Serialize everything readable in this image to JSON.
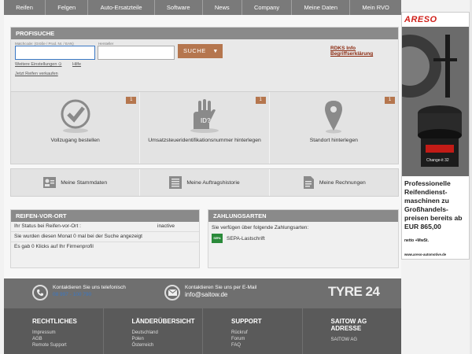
{
  "nav": {
    "items": [
      {
        "label": "Reifen"
      },
      {
        "label": "Felgen"
      },
      {
        "label": "Auto-Ersatzteile"
      },
      {
        "label": "Software"
      },
      {
        "label": "News"
      },
      {
        "label": "Company"
      },
      {
        "label": "Meine Daten"
      },
      {
        "label": "Mein RVO"
      }
    ]
  },
  "search": {
    "title": "PROFISUCHE",
    "field1_label": "Matchcode: (Größe / Prod. Nr. / EAN)",
    "field2_label": "Hersteller",
    "field1_value": "",
    "field2_value": "",
    "button_label": "SUCHE",
    "rdks_label": "RDKS Info",
    "legend_label": "Begriffserklärung",
    "more_settings": "Weitere Einstellungen",
    "help": "Hilfe",
    "sell_tires": "Jetzt Reifen verkaufen"
  },
  "tiles": [
    {
      "label": "Vollzugang bestellen",
      "badge": "1",
      "icon": "checkmark-circle-icon"
    },
    {
      "label": "Umsatzsteueridentifikationsnummer hinterlegen",
      "badge": "1",
      "icon": "id-hand-icon"
    },
    {
      "label": "Standort hinterlegen",
      "badge": "1",
      "icon": "location-pin-icon"
    }
  ],
  "tiles2": [
    {
      "label": "Meine Stammdaten",
      "icon": "profile-card-icon"
    },
    {
      "label": "Meine Auftragshistorie",
      "icon": "history-list-icon"
    },
    {
      "label": "Meine Rechnungen",
      "icon": "invoice-icon"
    }
  ],
  "reifen_vor_ort": {
    "title": "REIFEN-VOR-ORT",
    "status_label": "Ihr Status bei Reifen-vor-Ort :",
    "status_value": "inactive",
    "found_text": "Sie wurden diesen Monat 0 mal bei der Suche angezeigt",
    "clicks_text": "Es gab 0 Klicks auf Ihr Firmenprofil"
  },
  "zahlungsarten": {
    "title": "ZAHLUNGSARTEN",
    "intro": "Sie verfügen über folgende Zahlungsarten:",
    "method": "SEPA-Lastschrift",
    "method_icon_text": "SEPA"
  },
  "footer": {
    "phone_label": "Kontaktieren Sie uns telefonisch",
    "phone_number": "08 997 - 100 790",
    "email_label": "Kontaktieren Sie uns per E-Mail",
    "email": "info@saitow.de",
    "logo": "TYRE 24",
    "columns": [
      {
        "title": "RECHTLICHES",
        "links": [
          "Impressum",
          "AGB",
          "Remote Support"
        ]
      },
      {
        "title": "LÄNDERÜBERSICHT",
        "links": [
          "Deutschland",
          "Polen",
          "Österreich"
        ]
      },
      {
        "title": "SUPPORT",
        "links": [
          "Rückruf",
          "Forum",
          "FAQ"
        ]
      },
      {
        "title": "SAITOW AG ADRESSE",
        "links": [
          "SAITOW AG"
        ]
      }
    ]
  },
  "ad": {
    "brand": "ARESO",
    "product_caption": "Change-it 32",
    "headline": "Professionelle Reifendienst-maschinen zu Großhandels-preisen bereits ab EUR 865,00",
    "tax_note": "netto +MwSt.",
    "url": "www.areso-automotive.de"
  },
  "colors": {
    "nav_bg": "#7a7a7a",
    "accent": "#b5764e",
    "link_red": "#8b2a10",
    "footer_bg": "#5a5a5a"
  }
}
